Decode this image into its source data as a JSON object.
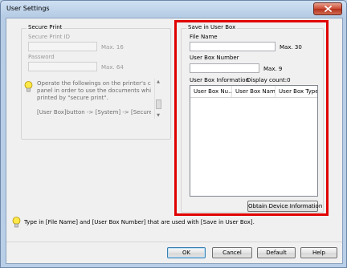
{
  "window": {
    "title": "User Settings"
  },
  "secure_print": {
    "group_label": "Secure Print",
    "id_label": "Secure Print ID",
    "id_max": "Max. 16",
    "password_label": "Password",
    "password_max": "Max. 64",
    "info_lines": [
      "Operate the followings on the printer's control",
      "panel in order to use the documents which is",
      "printed by \"secure print\".",
      "",
      "[User Box]button -> [System] -> [Secure"
    ]
  },
  "save_in_user_box": {
    "group_label": "Save in User Box",
    "file_name_label": "File Name",
    "file_name_value": "",
    "file_name_max": "Max. 30",
    "box_number_label": "User Box Number",
    "box_number_value": "",
    "box_number_max": "Max. 9",
    "info_label": "User Box Information",
    "display_count": "Display count:0",
    "columns": [
      "User Box Nu...",
      "User Box Name",
      "User Box Type"
    ],
    "obtain_button": "Obtain Device Information"
  },
  "hint": {
    "text": "Type in [File Name] and [User Box Number] that are used with [Save in User Box]."
  },
  "buttons": {
    "ok": "OK",
    "cancel": "Cancel",
    "default": "Default",
    "help": "Help"
  },
  "colors": {
    "highlight": "#e00000",
    "close_button": "#c94a33"
  }
}
